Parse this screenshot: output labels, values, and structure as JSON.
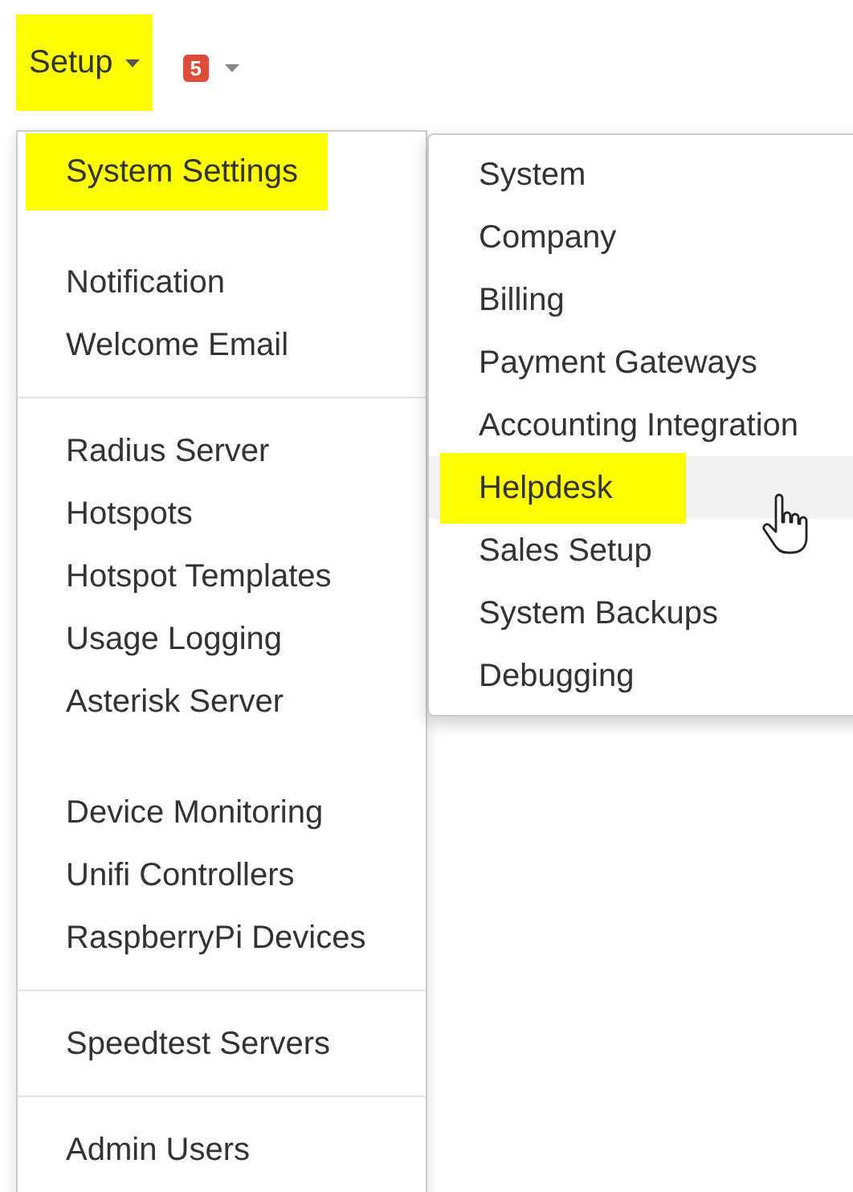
{
  "toolbar": {
    "setup_button": {
      "label": "Setup",
      "highlighted": true
    },
    "notification_badge": {
      "count": "5"
    }
  },
  "main_menu": {
    "sections": [
      {
        "items": [
          {
            "label": "System Settings",
            "highlighted": true
          }
        ]
      },
      {
        "divider": false,
        "items": [
          {
            "label": "Notification",
            "highlighted": false
          },
          {
            "label": "Welcome Email",
            "highlighted": false
          }
        ]
      },
      {
        "divider": true,
        "items": [
          {
            "label": "Radius Server",
            "highlighted": false
          },
          {
            "label": "Hotspots",
            "highlighted": false
          },
          {
            "label": "Hotspot Templates",
            "highlighted": false
          },
          {
            "label": "Usage Logging",
            "highlighted": false
          },
          {
            "label": "Asterisk Server",
            "highlighted": false
          }
        ]
      },
      {
        "divider": false,
        "items": [
          {
            "label": "Device Monitoring",
            "highlighted": false
          },
          {
            "label": "Unifi Controllers",
            "highlighted": false
          },
          {
            "label": "RaspberryPi Devices",
            "highlighted": false
          }
        ]
      },
      {
        "divider": true,
        "items": [
          {
            "label": "Speedtest Servers",
            "highlighted": false
          }
        ]
      },
      {
        "divider": true,
        "items": [
          {
            "label": "Admin Users",
            "highlighted": false
          }
        ]
      }
    ]
  },
  "submenu": {
    "items": [
      {
        "label": "System",
        "selected": false,
        "highlighted": false
      },
      {
        "label": "Company",
        "selected": false,
        "highlighted": false
      },
      {
        "label": "Billing",
        "selected": false,
        "highlighted": false
      },
      {
        "label": "Payment Gateways",
        "selected": false,
        "highlighted": false
      },
      {
        "label": "Accounting Integration",
        "selected": false,
        "highlighted": false
      },
      {
        "label": "Helpdesk",
        "selected": true,
        "highlighted": true
      },
      {
        "label": "Sales Setup",
        "selected": false,
        "highlighted": false
      },
      {
        "label": "System Backups",
        "selected": false,
        "highlighted": false
      },
      {
        "label": "Debugging",
        "selected": false,
        "highlighted": false
      }
    ]
  }
}
